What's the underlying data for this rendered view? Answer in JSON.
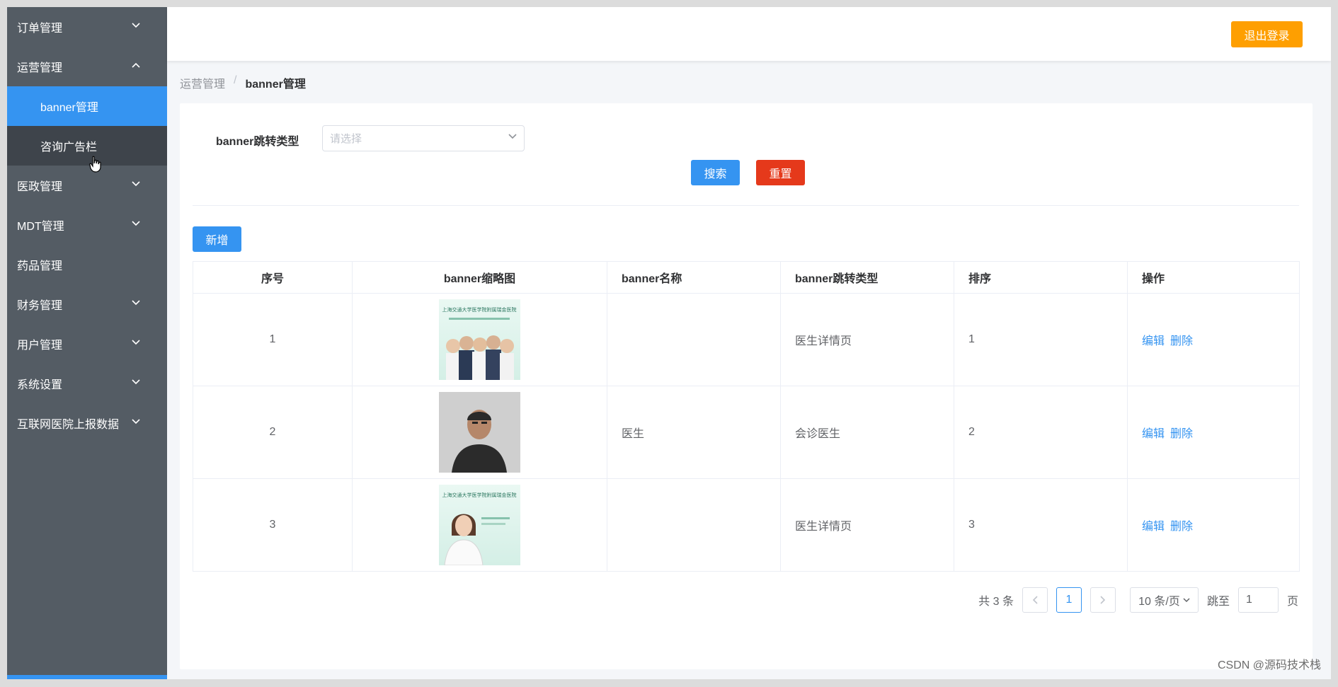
{
  "sidebar": {
    "items": [
      {
        "label": "订单管理",
        "expandable": true,
        "expanded": false
      },
      {
        "label": "运营管理",
        "expandable": true,
        "expanded": true
      },
      {
        "label": "banner管理",
        "sub": true,
        "active": true
      },
      {
        "label": "咨询广告栏",
        "sub": true,
        "active": false
      },
      {
        "label": "医政管理",
        "expandable": true,
        "expanded": false
      },
      {
        "label": "MDT管理",
        "expandable": true,
        "expanded": false
      },
      {
        "label": "药品管理",
        "expandable": false
      },
      {
        "label": "财务管理",
        "expandable": true,
        "expanded": false
      },
      {
        "label": "用户管理",
        "expandable": true,
        "expanded": false
      },
      {
        "label": "系统设置",
        "expandable": true,
        "expanded": false
      },
      {
        "label": "互联网医院上报数据",
        "expandable": true,
        "expanded": false
      }
    ]
  },
  "header": {
    "logout_label": "退出登录"
  },
  "breadcrumb": {
    "parent": "运营管理",
    "separator": "/",
    "current": "banner管理"
  },
  "filter": {
    "label": "banner跳转类型",
    "select_placeholder": "请选择",
    "search_label": "搜索",
    "reset_label": "重置"
  },
  "toolbar": {
    "add_label": "新增"
  },
  "table": {
    "headers": [
      "序号",
      "banner缩略图",
      "banner名称",
      "banner跳转类型",
      "排序",
      "操作"
    ],
    "rows": [
      {
        "index": "1",
        "thumb_text": "上海交通大学医学院附属瑞金医院",
        "name": "",
        "jump_type": "医生详情页",
        "sort": "1",
        "edit": "编辑",
        "delete": "删除"
      },
      {
        "index": "2",
        "thumb_text": "",
        "name": "医生",
        "jump_type": "会诊医生",
        "sort": "2",
        "edit": "编辑",
        "delete": "删除"
      },
      {
        "index": "3",
        "thumb_text": "上海交通大学医学院附属瑞金医院",
        "name": "",
        "jump_type": "医生详情页",
        "sort": "3",
        "edit": "编辑",
        "delete": "删除"
      }
    ]
  },
  "pagination": {
    "total_text": "共 3 条",
    "current_page": "1",
    "page_size": "10 条/页",
    "jump_label": "跳至",
    "jump_value": "1",
    "page_suffix": "页"
  },
  "watermark": "CSDN @源码技术栈",
  "colors": {
    "sidebar": "#545c64",
    "active": "#3594f1",
    "logout": "#fe9f01",
    "reset": "#e5391b"
  }
}
